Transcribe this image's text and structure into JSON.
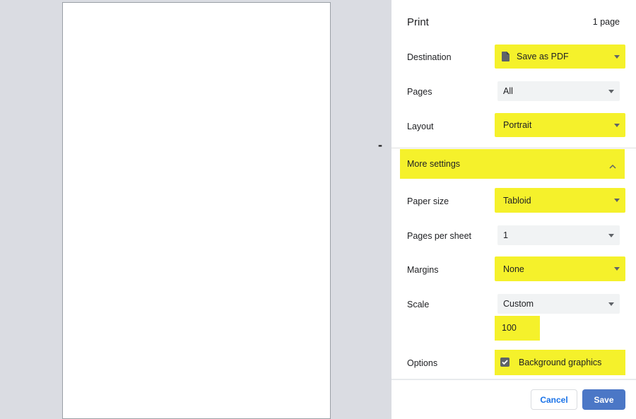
{
  "header": {
    "title": "Print",
    "page_count": "1 page"
  },
  "settings": {
    "destination": {
      "label": "Destination",
      "value": "Save as PDF"
    },
    "pages": {
      "label": "Pages",
      "value": "All"
    },
    "layout": {
      "label": "Layout",
      "value": "Portrait"
    },
    "more_settings": {
      "label": "More settings"
    },
    "paper_size": {
      "label": "Paper size",
      "value": "Tabloid"
    },
    "pages_per_sheet": {
      "label": "Pages per sheet",
      "value": "1"
    },
    "margins": {
      "label": "Margins",
      "value": "None"
    },
    "scale": {
      "label": "Scale",
      "value": "Custom",
      "custom_value": "100"
    },
    "options": {
      "label": "Options",
      "background_graphics": "Background graphics",
      "background_graphics_checked": true
    }
  },
  "footer": {
    "cancel_label": "Cancel",
    "save_label": "Save"
  },
  "preview": {
    "separator_glyph": "-"
  },
  "colors": {
    "highlight": "#f5f12b",
    "primary_button": "#4b77c6",
    "link_blue": "#1a73e8",
    "preview_bg": "#dadce2"
  },
  "icons": {
    "destination": "file-icon",
    "dropdown": "caret-down-icon",
    "more_settings": "chevron-up-icon",
    "checkbox": "check-icon"
  }
}
